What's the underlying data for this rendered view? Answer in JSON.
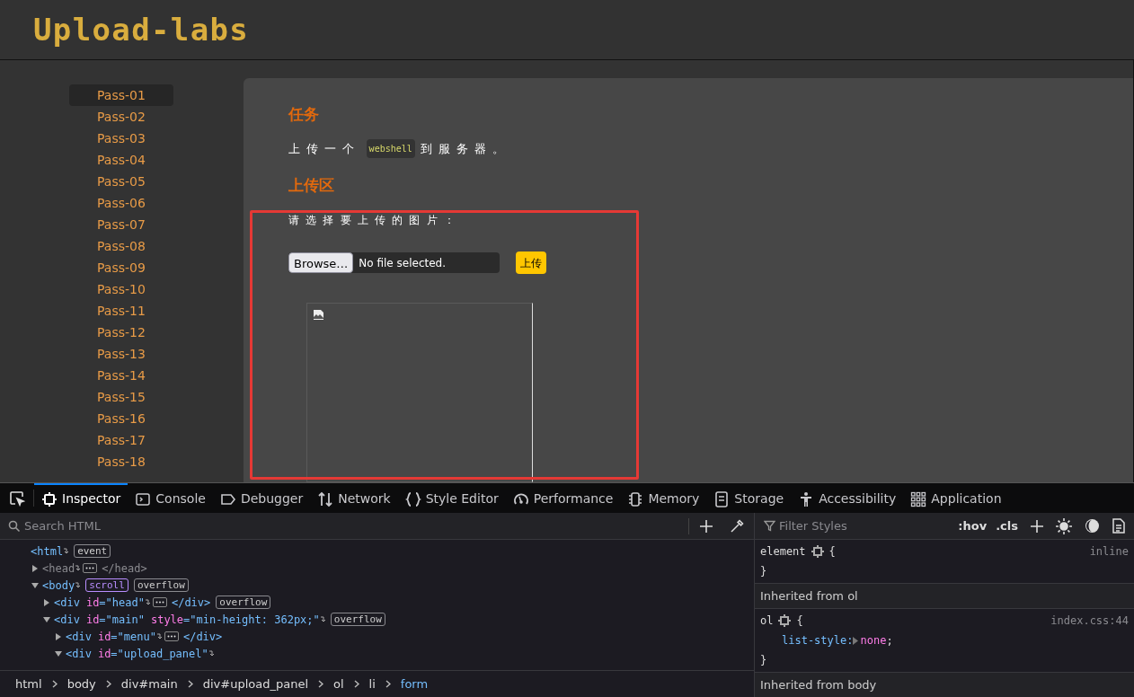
{
  "header": {
    "logo": "Upload-labs"
  },
  "menu": {
    "items": [
      {
        "label": "Pass-01",
        "selected": true
      },
      {
        "label": "Pass-02",
        "selected": false
      },
      {
        "label": "Pass-03",
        "selected": false
      },
      {
        "label": "Pass-04",
        "selected": false
      },
      {
        "label": "Pass-05",
        "selected": false
      },
      {
        "label": "Pass-06",
        "selected": false
      },
      {
        "label": "Pass-07",
        "selected": false
      },
      {
        "label": "Pass-08",
        "selected": false
      },
      {
        "label": "Pass-09",
        "selected": false
      },
      {
        "label": "Pass-10",
        "selected": false
      },
      {
        "label": "Pass-11",
        "selected": false
      },
      {
        "label": "Pass-12",
        "selected": false
      },
      {
        "label": "Pass-13",
        "selected": false
      },
      {
        "label": "Pass-14",
        "selected": false
      },
      {
        "label": "Pass-15",
        "selected": false
      },
      {
        "label": "Pass-16",
        "selected": false
      },
      {
        "label": "Pass-17",
        "selected": false
      },
      {
        "label": "Pass-18",
        "selected": false
      }
    ]
  },
  "task": {
    "title": "任务",
    "text_before": "上传一个",
    "code": "webshell",
    "text_after": "到服务器。"
  },
  "upload": {
    "title": "上传区",
    "prompt": "请选择要上传的图片：",
    "browse": "Browse…",
    "file_status": "No file selected.",
    "submit": "上传"
  },
  "devtools": {
    "tabs": [
      {
        "label": "Inspector",
        "selected": true
      },
      {
        "label": "Console",
        "selected": false
      },
      {
        "label": "Debugger",
        "selected": false
      },
      {
        "label": "Network",
        "selected": false
      },
      {
        "label": "Style Editor",
        "selected": false
      },
      {
        "label": "Performance",
        "selected": false
      },
      {
        "label": "Memory",
        "selected": false
      },
      {
        "label": "Storage",
        "selected": false
      },
      {
        "label": "Accessibility",
        "selected": false
      },
      {
        "label": "Application",
        "selected": false
      }
    ],
    "search_placeholder": "Search HTML",
    "filter_placeholder": "Filter Styles",
    "style_buttons": [
      ":hov",
      ".cls"
    ],
    "tree": [
      {
        "open": "<html",
        "dimmed": false,
        "badges": [
          {
            "label": "event",
            "kind": "plain"
          }
        ],
        "children": [
          {
            "open": "<head",
            "dimmed": true,
            "expanded": false,
            "close": "</head>"
          },
          {
            "open": "<body",
            "dimmed": false,
            "expanded": true,
            "badges": [
              {
                "label": "scroll",
                "kind": "scroll"
              },
              {
                "label": "overflow",
                "kind": "plain"
              }
            ],
            "children": [
              {
                "open": "<div",
                "dimmed": false,
                "expanded": false,
                "attrs": [
                  {
                    "name": "id",
                    "value": "=\"head\""
                  }
                ],
                "close": "</div>",
                "badges": [
                  {
                    "label": "overflow",
                    "kind": "plain"
                  }
                ]
              },
              {
                "open": "<div",
                "dimmed": false,
                "expanded": true,
                "attrs": [
                  {
                    "name": "id",
                    "value": "=\"main\""
                  },
                  {
                    "name": "style",
                    "value": "=\"min-height: 362px;\""
                  }
                ],
                "badges": [
                  {
                    "label": "overflow",
                    "kind": "plain"
                  }
                ],
                "children": [
                  {
                    "open": "<div",
                    "dimmed": false,
                    "expanded": false,
                    "attrs": [
                      {
                        "name": "id",
                        "value": "=\"menu\""
                      }
                    ],
                    "close": "</div>"
                  },
                  {
                    "open": "<div",
                    "dimmed": false,
                    "expanded": true,
                    "attrs": [
                      {
                        "name": "id",
                        "value": "=\"upload_panel\""
                      }
                    ]
                  }
                ]
              }
            ]
          }
        ]
      }
    ],
    "rules": [
      {
        "kind": "rule",
        "selector": "element",
        "open": "{",
        "source": "inline",
        "close": "}"
      },
      {
        "kind": "header",
        "label": "Inherited from ol"
      },
      {
        "kind": "rule",
        "selector": "ol",
        "open": "{",
        "source": "index.css:44",
        "declarations": [
          {
            "property": "list-style:",
            "value": "none",
            "end": ";"
          }
        ],
        "close": "}"
      },
      {
        "kind": "header",
        "label": "Inherited from body"
      }
    ],
    "breadcrumbs": [
      {
        "label": "html",
        "selected": false
      },
      {
        "label": "body",
        "selected": false
      },
      {
        "label": "div#main",
        "selected": false
      },
      {
        "label": "div#upload_panel",
        "selected": false
      },
      {
        "label": "ol",
        "selected": false
      },
      {
        "label": "li",
        "selected": false
      },
      {
        "label": "form",
        "selected": true
      }
    ]
  }
}
